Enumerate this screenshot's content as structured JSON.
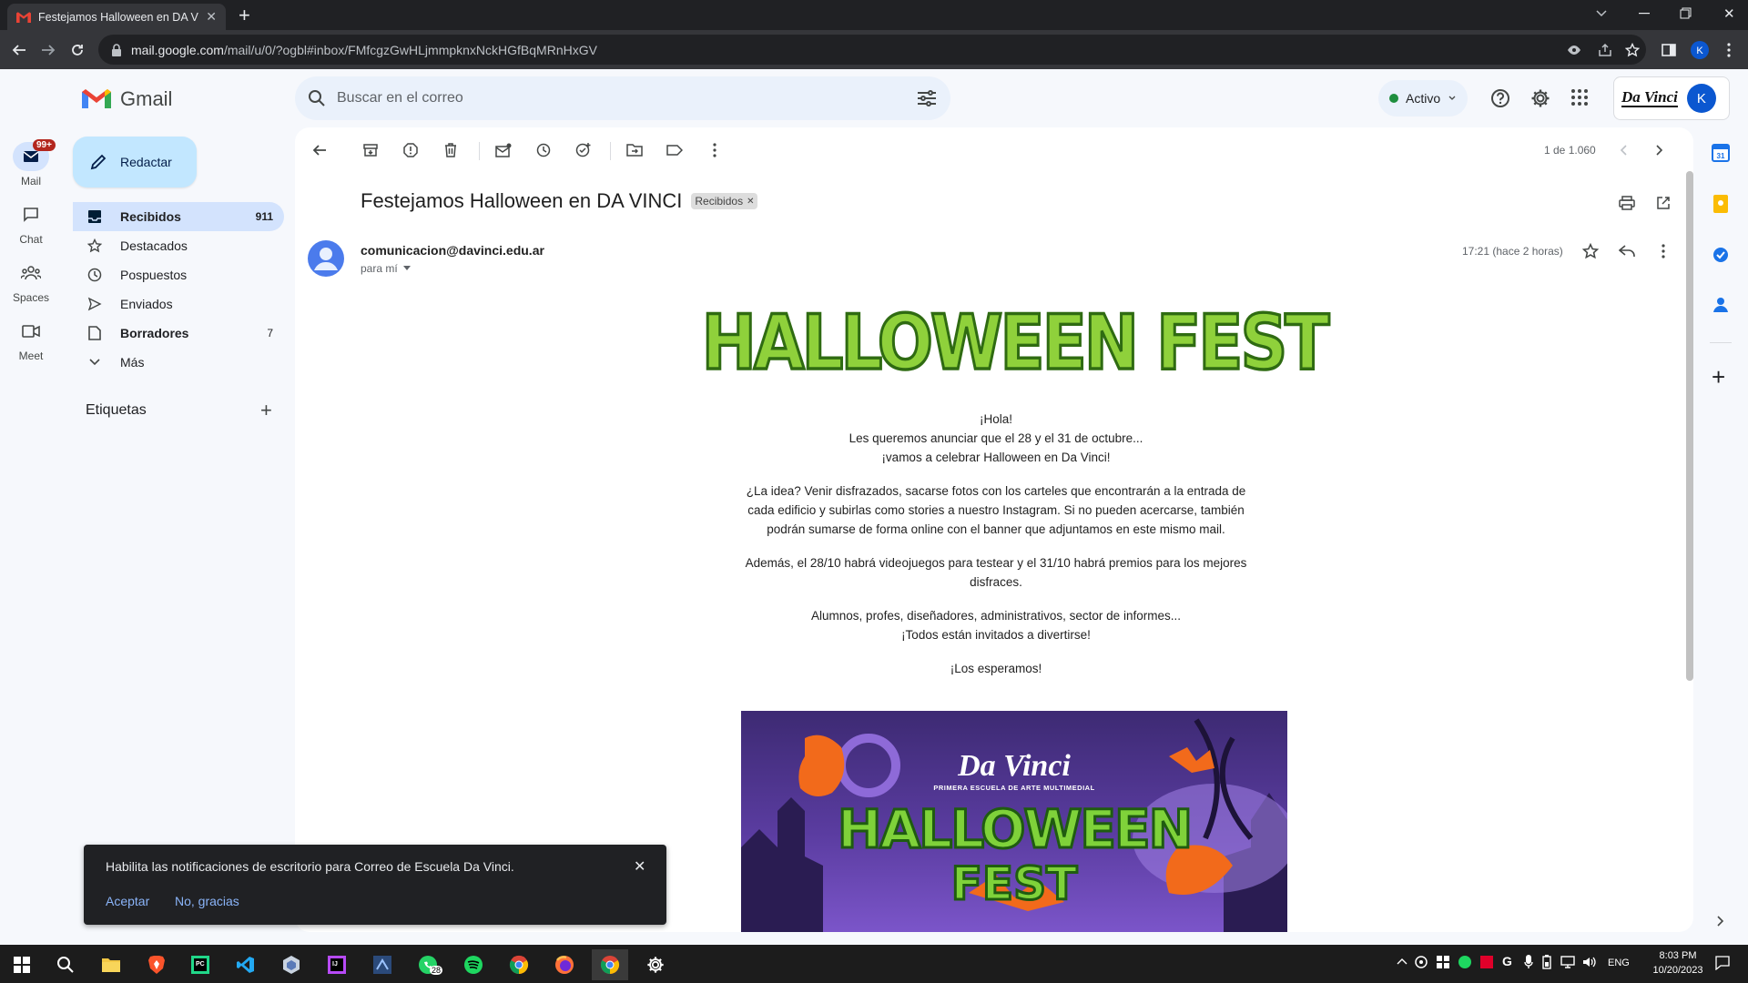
{
  "browser": {
    "tab_title": "Festejamos Halloween en DA VINCI",
    "url_host": "mail.google.com",
    "url_path": "/mail/u/0/?ogbl#inbox/FMfcgzGwHLjmmpknxNckHGfBqMRnHxGV"
  },
  "gmail": {
    "logo_text": "Gmail",
    "search_placeholder": "Buscar en el correo",
    "status": "Activo",
    "org_logo": "Da Vinci",
    "avatar_letter": "K"
  },
  "rail": [
    {
      "label": "Mail",
      "badge": "99+"
    },
    {
      "label": "Chat"
    },
    {
      "label": "Spaces"
    },
    {
      "label": "Meet"
    }
  ],
  "compose_label": "Redactar",
  "nav": [
    {
      "label": "Recibidos",
      "count": "911",
      "icon": "inbox-icon",
      "bold": true,
      "active": true
    },
    {
      "label": "Destacados",
      "count": "",
      "icon": "star-icon"
    },
    {
      "label": "Pospuestos",
      "count": "",
      "icon": "clock-icon"
    },
    {
      "label": "Enviados",
      "count": "",
      "icon": "send-icon"
    },
    {
      "label": "Borradores",
      "count": "7",
      "icon": "draft-icon",
      "bold": true
    },
    {
      "label": "Más",
      "count": "",
      "icon": "chevron-down-icon"
    }
  ],
  "labels_title": "Etiquetas",
  "pagination": "1 de 1.060",
  "email": {
    "subject": "Festejamos Halloween en DA VINCI",
    "label_chip": "Recibidos",
    "sender": "comunicacion@davinci.edu.ar",
    "to": "para mí",
    "time": "17:21 (hace 2 horas)",
    "banner_text": "HALLOWEEN FEST",
    "body": [
      [
        "¡Hola!",
        "Les queremos anunciar que el 28 y el 31 de octubre...",
        "¡vamos a celebrar Halloween en Da Vinci!"
      ],
      [
        "¿La idea? Venir disfrazados, sacarse fotos con los carteles que encontrarán a la entrada de cada edificio y subirlas como stories a nuestro Instagram. Si no pueden acercarse, también podrán sumarse de forma online con el banner que adjuntamos en este mismo mail."
      ],
      [
        "Además, el 28/10 habrá videojuegos para testear y el 31/10 habrá premios para los mejores disfraces."
      ],
      [
        "Alumnos, profes, diseñadores, administrativos, sector de informes...",
        "¡Todos están invitados a divertirse!"
      ],
      [
        "¡Los esperamos!"
      ]
    ],
    "poster": {
      "brand": "Da Vinci",
      "tagline": "PRIMERA ESCUELA DE ARTE MULTIMEDIAL",
      "title1": "HALLOWEEN",
      "title2": "FEST"
    }
  },
  "snackbar": {
    "message": "Habilita las notificaciones de escritorio para Correo de Escuela Da Vinci.",
    "accept": "Aceptar",
    "decline": "No, gracias"
  },
  "taskbar": {
    "lang": "ENG",
    "time": "8:03 PM",
    "date": "10/20/2023",
    "whatsapp_badge": "28"
  },
  "colors": {
    "accent": "#0b57d0",
    "compose": "#c2e7ff",
    "nav_active": "#d3e3fd",
    "status_green": "#1e8e3e",
    "badge_red": "#b3261e"
  }
}
